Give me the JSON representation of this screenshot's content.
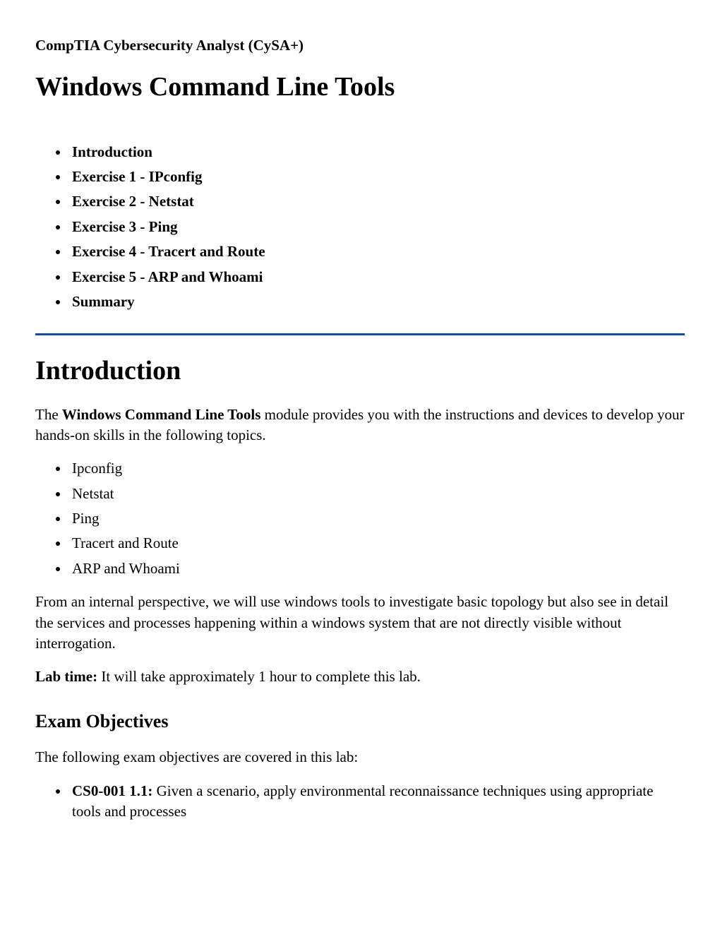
{
  "course": "CompTIA Cybersecurity Analyst (CySA+)",
  "title": "Windows Command Line Tools",
  "toc": [
    "Introduction",
    "Exercise 1 - IPconfig",
    "Exercise 2 - Netstat",
    "Exercise 3 - Ping",
    "Exercise 4 - Tracert and Route",
    "Exercise 5 - ARP and Whoami",
    "Summary"
  ],
  "intro": {
    "heading": "Introduction",
    "para1_prefix": "The ",
    "para1_bold": "Windows Command Line Tools",
    "para1_suffix": " module provides you with the instructions and devices to develop your hands-on skills in the following topics.",
    "topics": [
      "Ipconfig",
      "Netstat",
      "Ping",
      "Tracert and Route",
      "ARP and Whoami"
    ],
    "para2": "From an internal perspective, we will use windows tools to investigate basic topology but also see in detail the services and processes happening within a windows system that are not directly visible without interrogation.",
    "labtime_label": "Lab time:",
    "labtime_text": " It will take approximately 1 hour to complete this lab."
  },
  "exam": {
    "heading": "Exam Objectives",
    "intro": "The following exam objectives are covered in this lab:",
    "objectives": [
      {
        "code": "CS0-001 1.1:",
        "text": " Given a scenario, apply environmental reconnaissance techniques using appropriate tools and processes"
      }
    ]
  }
}
